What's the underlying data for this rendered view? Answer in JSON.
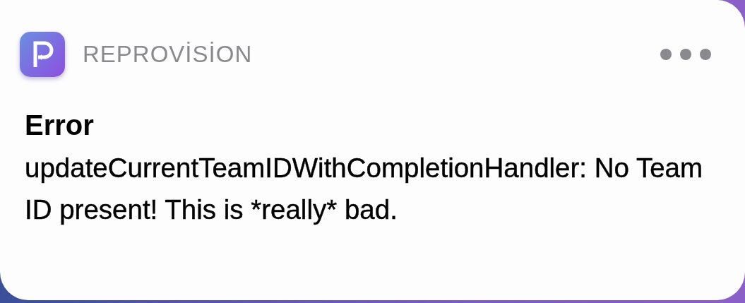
{
  "notification": {
    "app_name": "REPROVİSİON",
    "title": "Error",
    "message": "updateCurrentTeamIDWithCompletionHandler: No Team ID present! This is *really* bad."
  }
}
